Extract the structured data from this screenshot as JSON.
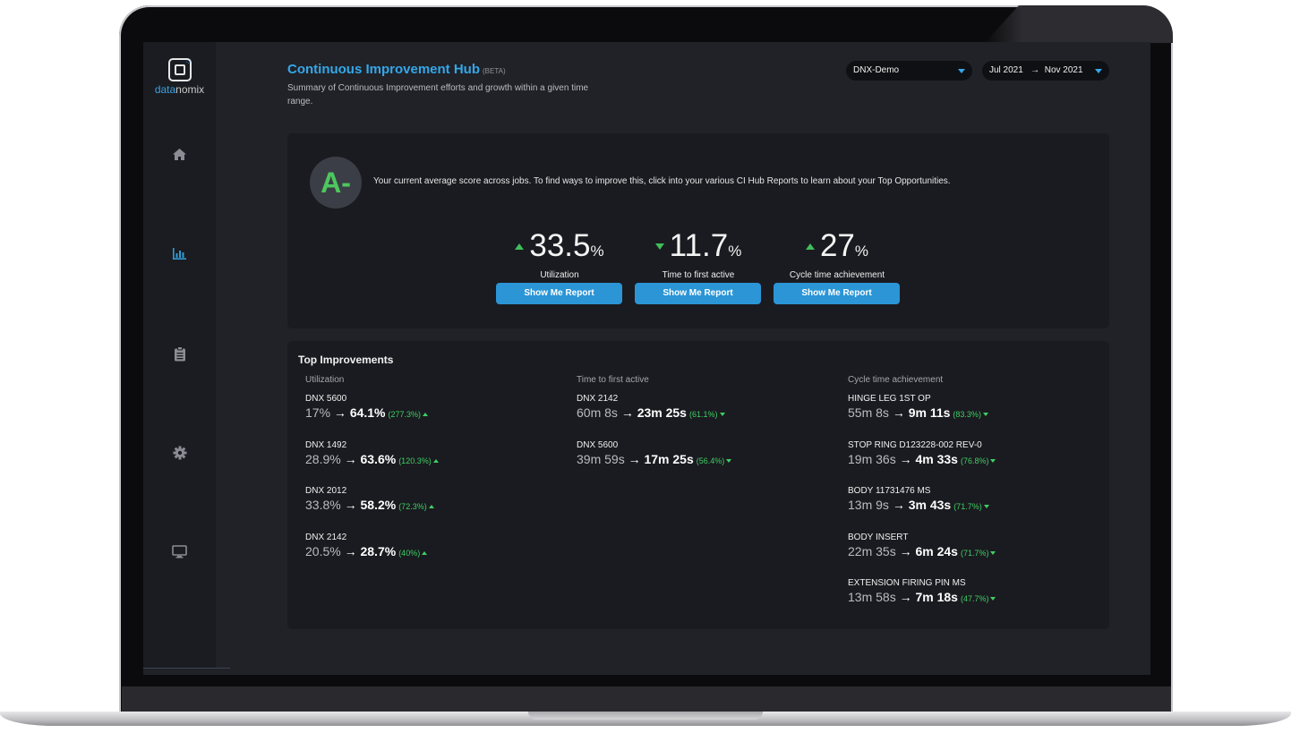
{
  "brand": {
    "name_part1": "data",
    "name_part2": "nomix"
  },
  "header": {
    "title": "Continuous Improvement Hub",
    "badge": "(BETA)",
    "subtitle": "Summary of Continuous Improvement efforts and growth within a given time range.",
    "org_select": "DNX-Demo",
    "date_from": "Jul 2021",
    "date_arrow": "→",
    "date_to": "Nov 2021"
  },
  "nav": [
    "home-icon",
    "bar-chart-icon",
    "clipboard-icon",
    "gear-icon",
    "monitor-icon"
  ],
  "score": {
    "grade": "A-",
    "text": "Your current average score across jobs. To find ways to improve this, click into your various CI Hub Reports to learn about your Top Opportunities."
  },
  "metrics": [
    {
      "value": "33.5",
      "unit": "%",
      "trend": "up",
      "label": "Utilization",
      "button": "Show Me Report"
    },
    {
      "value": "11.7",
      "unit": "%",
      "trend": "down",
      "label": "Time to first active",
      "button": "Show Me Report"
    },
    {
      "value": "27",
      "unit": "%",
      "trend": "up",
      "label": "Cycle time achievement",
      "button": "Show Me Report"
    }
  ],
  "improvements": {
    "title": "Top Improvements",
    "arrow": "→",
    "columns": [
      {
        "header": "Utilization",
        "items": [
          {
            "name": "DNX 5600",
            "from": "17%",
            "to": "64.1%",
            "change": "(277.3%)",
            "trend": "up"
          },
          {
            "name": "DNX 1492",
            "from": "28.9%",
            "to": "63.6%",
            "change": "(120.3%)",
            "trend": "up"
          },
          {
            "name": "DNX 2012",
            "from": "33.8%",
            "to": "58.2%",
            "change": "(72.3%)",
            "trend": "up"
          },
          {
            "name": "DNX 2142",
            "from": "20.5%",
            "to": "28.7%",
            "change": "(40%)",
            "trend": "up"
          }
        ]
      },
      {
        "header": "Time to first active",
        "items": [
          {
            "name": "DNX 2142",
            "from": "60m 8s",
            "to": "23m 25s",
            "change": "(61.1%)",
            "trend": "down"
          },
          {
            "name": "DNX 5600",
            "from": "39m 59s",
            "to": "17m 25s",
            "change": "(56.4%)",
            "trend": "down"
          }
        ]
      },
      {
        "header": "Cycle time achievement",
        "items": [
          {
            "name": "HINGE LEG 1ST OP",
            "from": "55m 8s",
            "to": "9m 11s",
            "change": "(83.3%)",
            "trend": "down"
          },
          {
            "name": "STOP RING D123228-002 REV-0",
            "from": "19m 36s",
            "to": "4m 33s",
            "change": "(76.8%)",
            "trend": "down"
          },
          {
            "name": "BODY 11731476 MS",
            "from": "13m 9s",
            "to": "3m 43s",
            "change": "(71.7%)",
            "trend": "down"
          },
          {
            "name": "BODY INSERT",
            "from": "22m 35s",
            "to": "6m 24s",
            "change": "(71.7%)",
            "trend": "down"
          },
          {
            "name": "EXTENSION FIRING PIN MS",
            "from": "13m 58s",
            "to": "7m 18s",
            "change": "(47.7%)",
            "trend": "down"
          }
        ]
      }
    ]
  }
}
